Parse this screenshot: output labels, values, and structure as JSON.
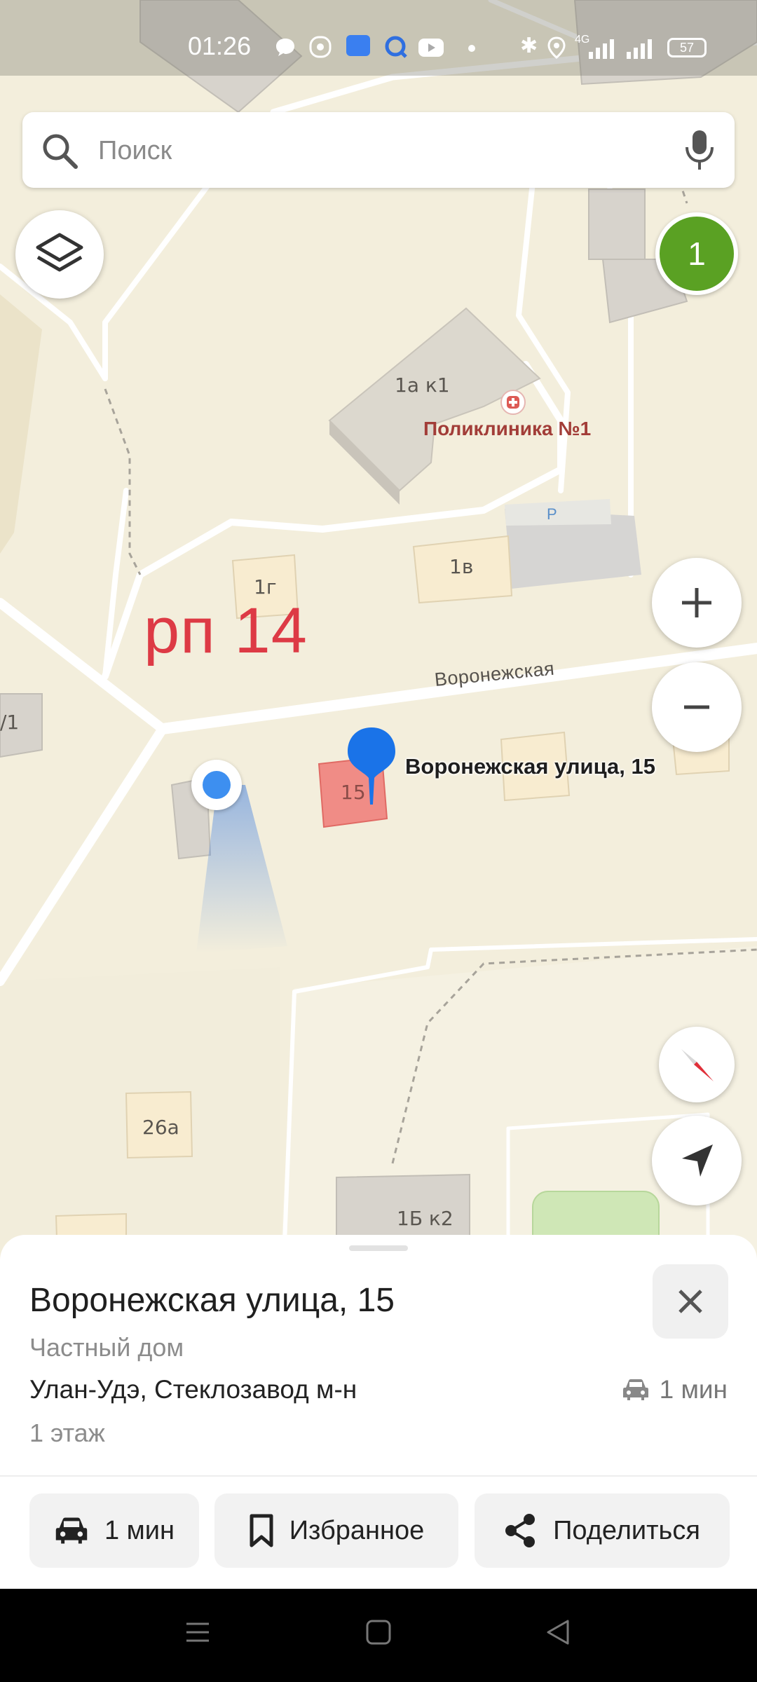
{
  "status_bar": {
    "time": "01:26",
    "battery": "57",
    "network": "4G"
  },
  "search": {
    "placeholder": "Поиск"
  },
  "map": {
    "badge_count": "1",
    "annotation": "рп 14",
    "street_name": "Воронежская",
    "poi_name": "Поликлиника №1",
    "parking_label": "P",
    "pin_label": "Воронежская улица, 15",
    "buildings": {
      "b1a_k1": "1а к1",
      "b1v": "1в",
      "b1g": "1г",
      "b15": "15",
      "b26a": "26а",
      "b1b_k2": "1Б к2",
      "b_left": "/1"
    },
    "icons": {
      "layers": "layers-icon",
      "zoom_in": "plus-icon",
      "zoom_out": "minus-icon",
      "compass": "compass-icon",
      "my_location": "navigation-arrow-icon",
      "microphone": "microphone-icon",
      "search": "search-icon",
      "hospital": "hospital-icon"
    },
    "colors": {
      "selected_building": "#f08c86",
      "pin": "#1a73e8",
      "badge": "#5aa123",
      "annotation": "#dd3a45"
    }
  },
  "place": {
    "title": "Воронежская улица, 15",
    "type": "Частный дом",
    "address": "Улан-Удэ, Стеклозавод м-н",
    "floors": "1 этаж",
    "travel_time": "1 мин"
  },
  "actions": {
    "route_label": "1 мин",
    "favorite_label": "Избранное",
    "share_label": "Поделиться"
  }
}
